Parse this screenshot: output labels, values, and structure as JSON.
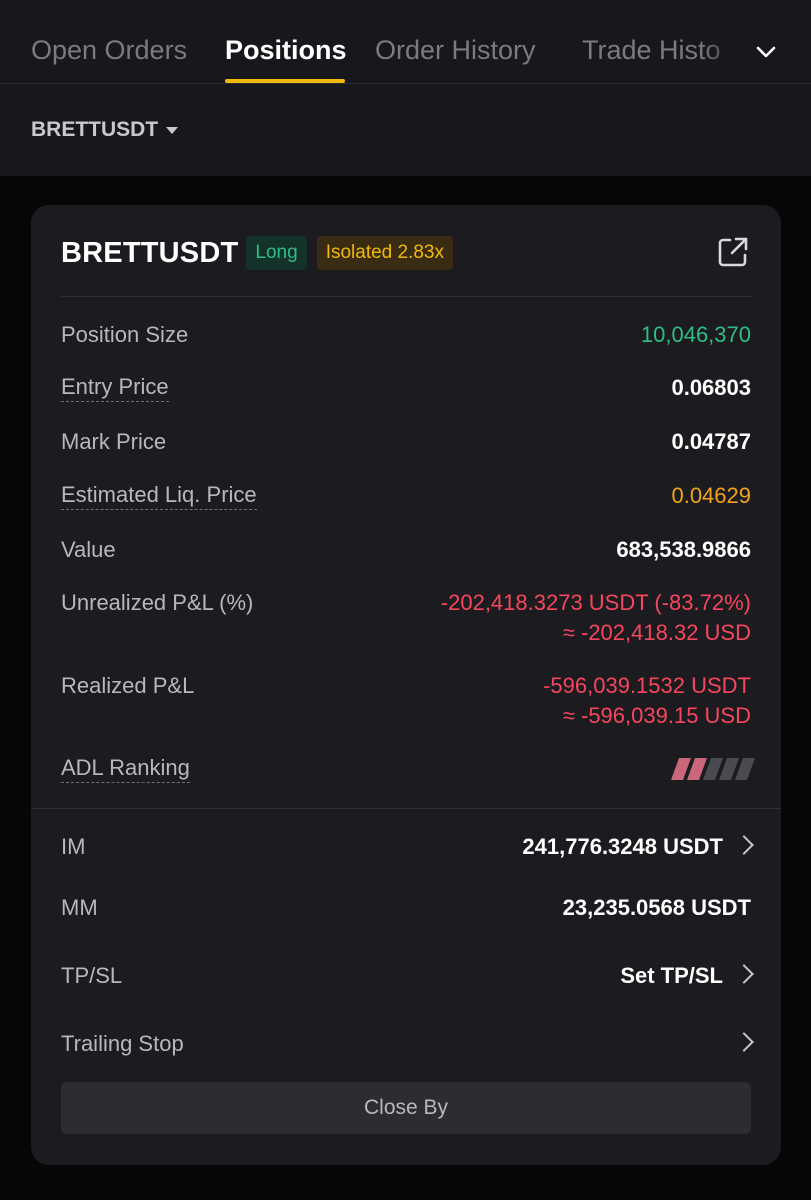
{
  "tabs": [
    {
      "label": "Open Orders",
      "active": false
    },
    {
      "label": "Positions",
      "active": true
    },
    {
      "label": "Order History",
      "active": false
    },
    {
      "label": "Trade Histo",
      "active": false
    }
  ],
  "tabs_more_icon": "chevron-down-icon",
  "symbol_filter": {
    "label": "BRETTUSDT"
  },
  "position": {
    "symbol": "BRETTUSDT",
    "side": "Long",
    "margin_mode": "Isolated 2.83x",
    "share_icon": "external-link-icon",
    "position_size_label": "Position Size",
    "position_size": "10,046,370",
    "entry_price_label": "Entry Price",
    "entry_price": "0.06803",
    "mark_price_label": "Mark Price",
    "mark_price": "0.04787",
    "liq_price_label": "Estimated Liq. Price",
    "liq_price": "0.04629",
    "value_label": "Value",
    "value": "683,538.9866",
    "unrealized_label": "Unrealized P&L (%)",
    "unrealized": "-202,418.3273 USDT (-83.72%)",
    "unrealized_usd": "≈ -202,418.32 USD",
    "realized_label": "Realized P&L",
    "realized": "-596,039.1532 USDT",
    "realized_usd": "≈ -596,039.15 USD",
    "adl_label": "ADL Ranking",
    "adl_level": 2,
    "adl_max": 5,
    "im_label": "IM",
    "im": "241,776.3248 USDT",
    "mm_label": "MM",
    "mm": "23,235.0568 USDT",
    "tpsl_label": "TP/SL",
    "tpsl_action": "Set TP/SL",
    "trailing_label": "Trailing Stop",
    "close_by": "Close By"
  },
  "colors": {
    "accent": "#f0b90b",
    "positive": "#2ebd85",
    "negative": "#f6465d",
    "warning": "#f0a31c"
  }
}
